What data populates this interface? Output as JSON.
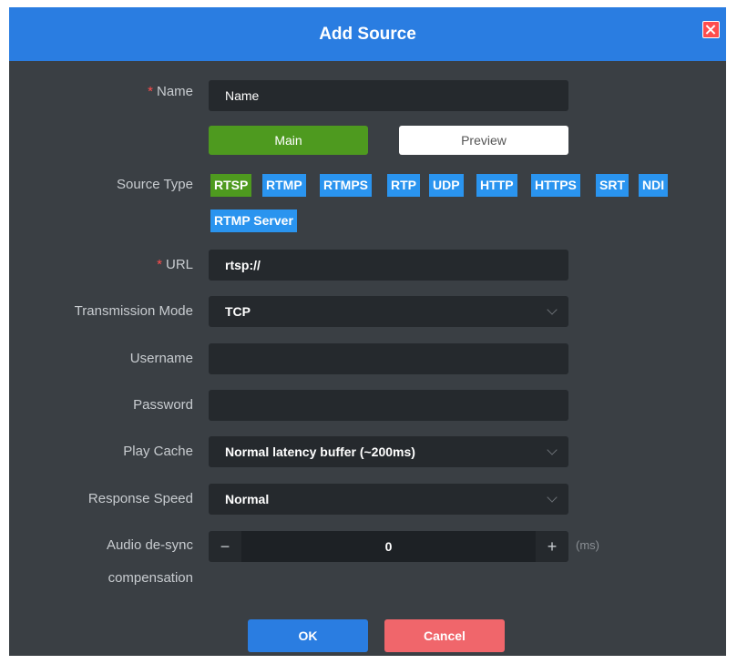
{
  "dialog": {
    "title": "Add Source",
    "close_icon": "close-icon",
    "accent_color": "#2a7de1"
  },
  "name": {
    "required_mark": "*",
    "label": "Name",
    "value": "Name"
  },
  "stream_tabs": {
    "main_label": "Main",
    "preview_label": "Preview",
    "active": "Main"
  },
  "source_type": {
    "label": "Source Type",
    "options": [
      "RTSP",
      "RTMP",
      "RTMPS",
      "RTP",
      "UDP",
      "HTTP",
      "HTTPS",
      "SRT",
      "NDI",
      "RTMP Server"
    ],
    "selected": "RTSP"
  },
  "url": {
    "required_mark": "*",
    "label": "URL",
    "value": "rtsp://"
  },
  "transmission_mode": {
    "label": "Transmission Mode",
    "value": "TCP"
  },
  "username": {
    "label": "Username",
    "value": ""
  },
  "password": {
    "label": "Password",
    "value": ""
  },
  "play_cache": {
    "label": "Play Cache",
    "value": "Normal latency buffer (~200ms)"
  },
  "response_speed": {
    "label": "Response Speed",
    "value": "Normal"
  },
  "audio_desync": {
    "label_line1": "Audio de-sync",
    "label_line2": "compensation",
    "decrement": "−",
    "value": "0",
    "increment": "+",
    "unit": "(ms)"
  },
  "footer": {
    "ok_label": "OK",
    "cancel_label": "Cancel"
  }
}
